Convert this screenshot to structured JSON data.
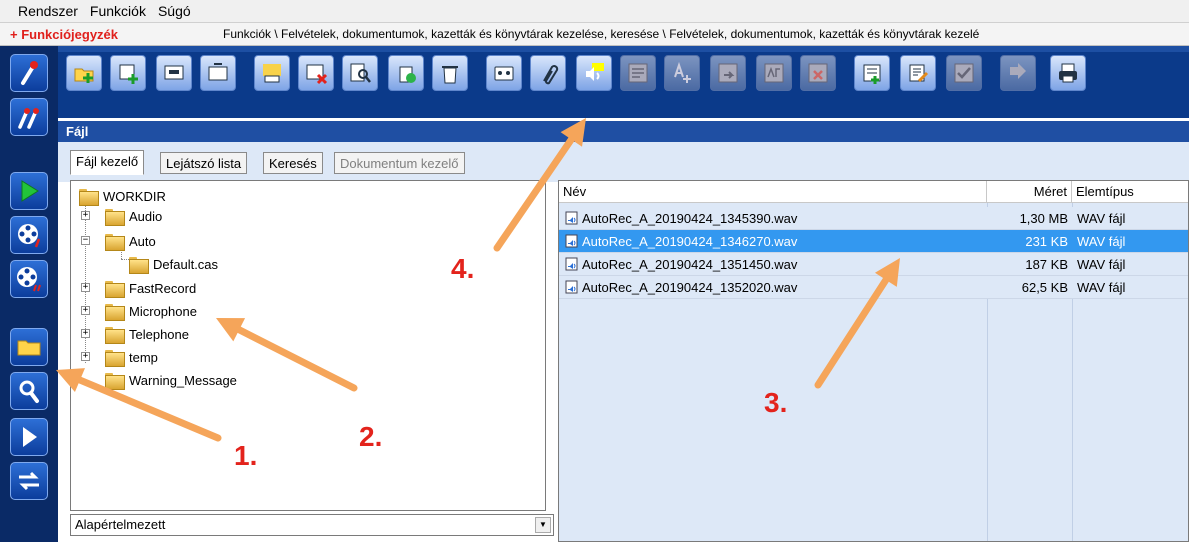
{
  "menu": {
    "items": [
      "Rendszer",
      "Funkciók",
      "Súgó"
    ]
  },
  "crumb": {
    "title": "+ Funkciójegyzék",
    "path": "Funkciók \\ Felvételek, dokumentumok, kazetták és könyvtárak kezelése, keresése \\ Felvételek, dokumentumok, kazetták és könyvtárak kezelé"
  },
  "sidebar": {
    "buttons": [
      "microphone-icon",
      "double-mic-icon",
      "play-icon",
      "film-reel-icon",
      "film-reel-record-icon",
      "folder-icon",
      "search-icon",
      "play-outline-icon",
      "transfer-icon"
    ]
  },
  "toolbar": {
    "buttons": [
      {
        "icon": "new-folder-icon",
        "enabled": true
      },
      {
        "icon": "add-cassette-icon",
        "enabled": true
      },
      {
        "icon": "cassette-export-icon",
        "enabled": true
      },
      {
        "icon": "cassette-import-icon",
        "enabled": true
      },
      {
        "icon": "rename-icon",
        "enabled": true
      },
      {
        "icon": "delete-cassette-icon",
        "enabled": true
      },
      {
        "icon": "find-document-icon",
        "enabled": true
      },
      {
        "icon": "recycle-icon",
        "enabled": true
      },
      {
        "icon": "trash-icon",
        "enabled": true
      },
      {
        "icon": "cassette-icon",
        "enabled": true
      },
      {
        "icon": "paperclip-icon",
        "enabled": true
      },
      {
        "icon": "text-to-speech-icon",
        "enabled": true
      },
      {
        "icon": "txt-edit-icon",
        "enabled": false
      },
      {
        "icon": "translate-icon",
        "enabled": false
      },
      {
        "icon": "rtf-export-icon",
        "enabled": false
      },
      {
        "icon": "rtf-spell-icon",
        "enabled": false
      },
      {
        "icon": "rtf-delete-icon",
        "enabled": false
      },
      {
        "icon": "list-add-icon",
        "enabled": true
      },
      {
        "icon": "document-edit-icon",
        "enabled": true
      },
      {
        "icon": "checklist-icon",
        "enabled": false
      },
      {
        "icon": "binary-icon",
        "enabled": false
      },
      {
        "icon": "print-icon",
        "enabled": true
      }
    ]
  },
  "panel": {
    "title": "Fájl"
  },
  "tabs": [
    {
      "label": "Fájl kezelő",
      "state": "active"
    },
    {
      "label": "Lejátszó lista",
      "state": "normal"
    },
    {
      "label": "Keresés",
      "state": "normal"
    },
    {
      "label": "Dokumentum kezelő",
      "state": "disabled"
    }
  ],
  "tree": {
    "root": "WORKDIR",
    "nodes": [
      {
        "label": "Audio",
        "expander": "+"
      },
      {
        "label": "Auto",
        "expander": "−"
      },
      {
        "label": "Default.cas",
        "expander": ""
      },
      {
        "label": "FastRecord",
        "expander": "+"
      },
      {
        "label": "Microphone",
        "expander": "+"
      },
      {
        "label": "Telephone",
        "expander": "+"
      },
      {
        "label": "temp",
        "expander": "+"
      },
      {
        "label": "Warning_Message",
        "expander": ""
      }
    ]
  },
  "combo": {
    "value": "Alapértelmezett"
  },
  "files": {
    "columns": [
      "Név",
      "Méret",
      "Elemtípus"
    ],
    "rows": [
      {
        "name": "AutoRec_A_20190424_1345390.wav",
        "size": "1,30 MB",
        "type": "WAV fájl",
        "selected": false
      },
      {
        "name": "AutoRec_A_20190424_1346270.wav",
        "size": "231 KB",
        "type": "WAV fájl",
        "selected": true
      },
      {
        "name": "AutoRec_A_20190424_1351450.wav",
        "size": "187 KB",
        "type": "WAV fájl",
        "selected": false
      },
      {
        "name": "AutoRec_A_20190424_1352020.wav",
        "size": "62,5 KB",
        "type": "WAV fájl",
        "selected": false
      }
    ]
  },
  "annotations": [
    "1.",
    "2.",
    "3.",
    "4."
  ],
  "colors": {
    "arrow": "#f5a55a",
    "annotation_text": "#e3231c",
    "selection": "#3398f0",
    "toolbar_bg": "#0b3a8a"
  }
}
